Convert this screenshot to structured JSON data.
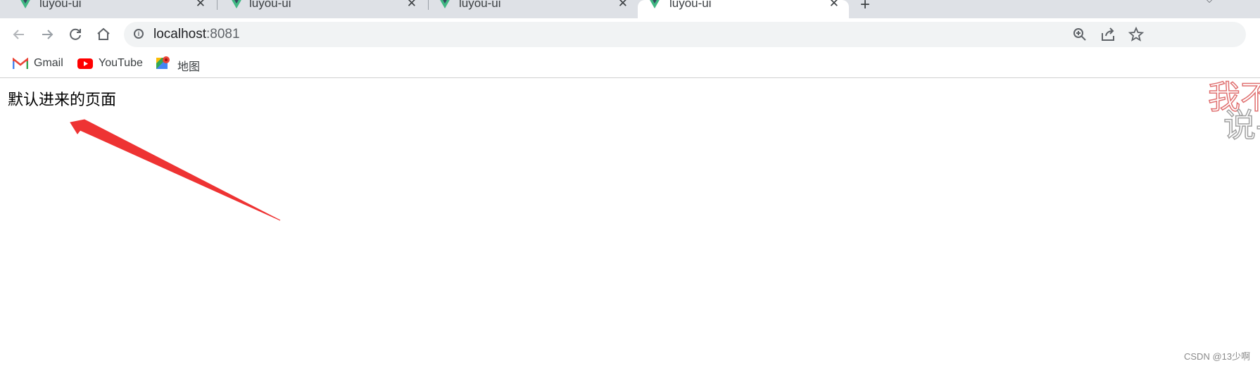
{
  "tabs": [
    {
      "title": "luyou-ui",
      "active": false
    },
    {
      "title": "luyou-ui",
      "active": false
    },
    {
      "title": "luyou-ui",
      "active": false
    },
    {
      "title": "luyou-ui",
      "active": true
    }
  ],
  "tab_close_glyph": "✕",
  "new_tab_glyph": "+",
  "toolbar": {
    "back_icon": "back-arrow-icon",
    "forward_icon": "forward-arrow-icon",
    "reload_icon": "reload-icon",
    "home_icon": "home-icon",
    "url_host": "localhost",
    "url_port": ":8081",
    "zoom_icon": "zoom-icon",
    "share_icon": "share-icon",
    "star_icon": "star-icon"
  },
  "bookmarks": [
    {
      "label": "Gmail",
      "icon": "gmail-icon"
    },
    {
      "label": "YouTube",
      "icon": "youtube-icon"
    },
    {
      "label": "地图",
      "icon": "maps-icon"
    }
  ],
  "page": {
    "text": "默认进来的页面"
  },
  "overlay": {
    "deco_line1": "我不",
    "deco_line2": "说-",
    "watermark": "CSDN @13少啊"
  },
  "colors": {
    "arrow": "#ee3333",
    "vue_green": "#41b883",
    "vue_dark": "#35495e"
  }
}
